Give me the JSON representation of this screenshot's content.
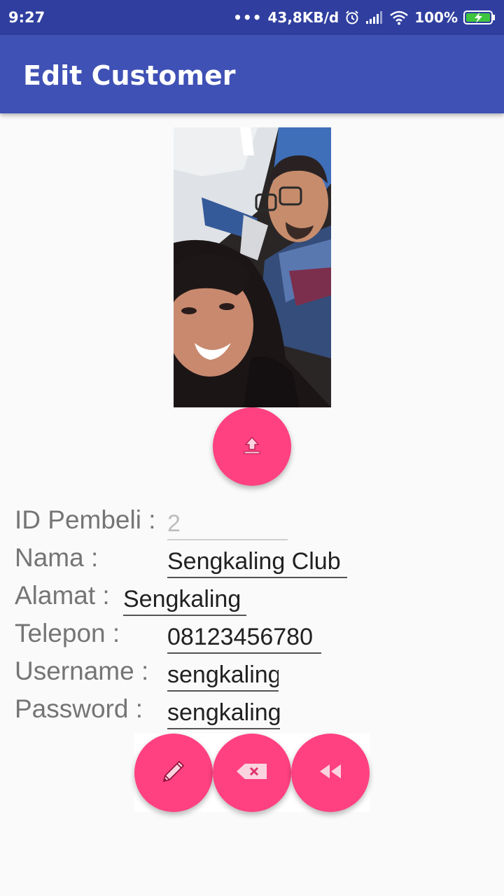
{
  "status_bar": {
    "time": "9:27",
    "dots": "•••",
    "net_speed": "43,8KB/d",
    "battery": "100%"
  },
  "app_bar": {
    "title": "Edit Customer"
  },
  "form": {
    "id_label": "ID Pembeli :",
    "id_value": "2",
    "nama_label": "Nama :",
    "nama_value": "Sengkaling Club",
    "alamat_label": "Alamat :",
    "alamat_value": "Sengkaling",
    "telepon_label": "Telepon :",
    "telepon_value": "08123456780",
    "username_label": "Username :",
    "username_value": "sengkaling",
    "password_label": "Password :",
    "password_value": "sengkaling"
  },
  "icons": {
    "upload": "upload-icon",
    "edit": "pencil-icon",
    "delete": "backspace-icon",
    "back": "rewind-icon"
  },
  "colors": {
    "status_bar": "#303f9f",
    "app_bar": "#3f51b5",
    "accent": "#ff4081"
  }
}
